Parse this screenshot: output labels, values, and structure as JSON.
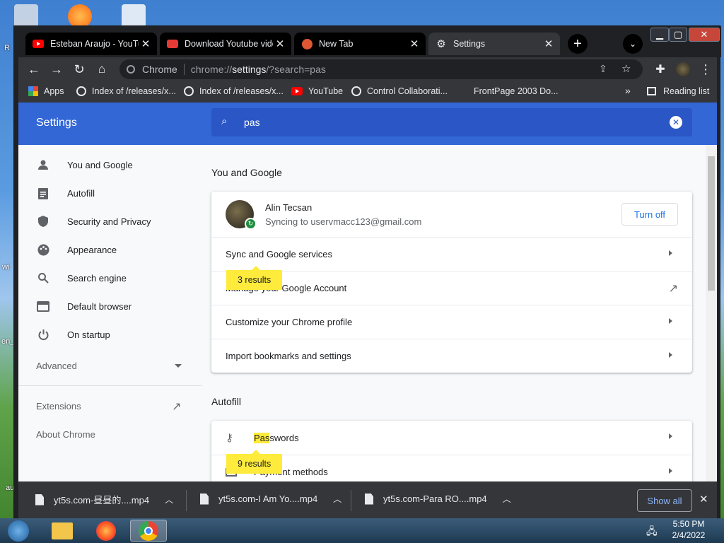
{
  "desktop": {
    "labels": [
      "R",
      "wi",
      "en_",
      "au"
    ]
  },
  "tabs": [
    {
      "title": "Esteban Araujo - YouTube",
      "favicon": "youtube-icon"
    },
    {
      "title": "Download Youtube video",
      "favicon": "yt5s-icon"
    },
    {
      "title": "New Tab",
      "favicon": "duckduckgo-icon"
    },
    {
      "title": "Settings",
      "favicon": "gear-icon"
    }
  ],
  "omnibox": {
    "origin": "Chrome",
    "url_prefix": "chrome://",
    "url_host": "settings",
    "url_path": "/?search=pas"
  },
  "bookmarks": [
    {
      "label": "Apps",
      "icon": "apps-grid-icon"
    },
    {
      "label": "Index of /releases/x...",
      "icon": "globe-icon"
    },
    {
      "label": "Index of /releases/x...",
      "icon": "globe-icon"
    },
    {
      "label": "YouTube",
      "icon": "youtube-icon"
    },
    {
      "label": "Control Collaborati...",
      "icon": "globe-icon"
    },
    {
      "label": "FrontPage 2003 Do...",
      "icon": "page-icon"
    }
  ],
  "bookmarks_more": "»",
  "reading_list": "Reading list",
  "settings": {
    "title": "Settings",
    "search_value": "pas",
    "nav": [
      {
        "label": "You and Google",
        "icon": "person-icon"
      },
      {
        "label": "Autofill",
        "icon": "clipboard-icon"
      },
      {
        "label": "Security and Privacy",
        "icon": "shield-icon"
      },
      {
        "label": "Appearance",
        "icon": "palette-icon"
      },
      {
        "label": "Search engine",
        "icon": "search-icon"
      },
      {
        "label": "Default browser",
        "icon": "browser-icon"
      },
      {
        "label": "On startup",
        "icon": "power-icon"
      }
    ],
    "advanced": "Advanced",
    "extensions": "Extensions",
    "about": "About Chrome",
    "section_you": "You and Google",
    "account": {
      "name": "Alin Tecsan",
      "status": "Syncing to uservmacc123@gmail.com",
      "turn_off": "Turn off"
    },
    "rows_you": [
      "Sync and Google services",
      "Manage your Google Account",
      "Customize your Chrome profile",
      "Import bookmarks and settings"
    ],
    "bubble_you": "3 results",
    "section_autofill": "Autofill",
    "pw_highlight": "Pas",
    "pw_rest": "swords",
    "payment": "Payment methods",
    "bubble_autofill": "9 results"
  },
  "downloads": [
    {
      "name": "yt5s.com-昼昼的....mp4"
    },
    {
      "name": "yt5s.com-I Am Yo....mp4"
    },
    {
      "name": "yt5s.com-Para RO....mp4"
    }
  ],
  "show_all": "Show all",
  "taskbar": {
    "time": "5:50 PM",
    "date": "2/4/2022"
  }
}
